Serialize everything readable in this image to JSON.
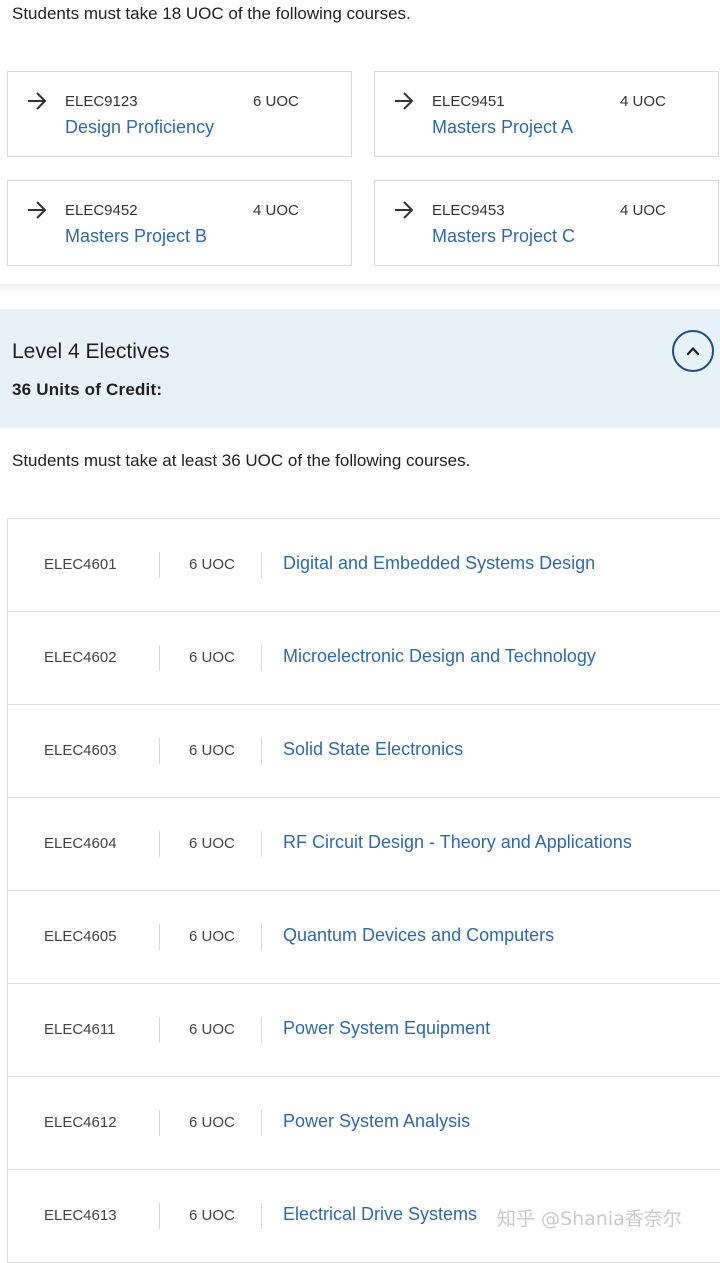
{
  "core": {
    "intro": "Students must take 18 UOC of the following courses.",
    "courses": [
      {
        "code": "ELEC9123",
        "uoc": "6 UOC",
        "title": "Design Proficiency"
      },
      {
        "code": "ELEC9451",
        "uoc": "4 UOC",
        "title": "Masters Project A"
      },
      {
        "code": "ELEC9452",
        "uoc": "4 UOC",
        "title": "Masters Project B"
      },
      {
        "code": "ELEC9453",
        "uoc": "4 UOC",
        "title": "Masters Project C"
      }
    ],
    "arrow_icon": "arrow-right-icon"
  },
  "electives": {
    "heading": "Level 4 Electives",
    "credits": "36 Units of Credit:",
    "toggle_icon": "chevron-up-icon",
    "intro": "Students must take at least 36 UOC of the following courses.",
    "courses": [
      {
        "code": "ELEC4601",
        "uoc": "6 UOC",
        "title": "Digital and Embedded Systems Design"
      },
      {
        "code": "ELEC4602",
        "uoc": "6 UOC",
        "title": "Microelectronic Design and Technology"
      },
      {
        "code": "ELEC4603",
        "uoc": "6 UOC",
        "title": "Solid State Electronics"
      },
      {
        "code": "ELEC4604",
        "uoc": "6 UOC",
        "title": "RF Circuit Design - Theory and Applications"
      },
      {
        "code": "ELEC4605",
        "uoc": "6 UOC",
        "title": "Quantum Devices and Computers"
      },
      {
        "code": "ELEC4611",
        "uoc": "6 UOC",
        "title": "Power System Equipment"
      },
      {
        "code": "ELEC4612",
        "uoc": "6 UOC",
        "title": "Power System Analysis"
      },
      {
        "code": "ELEC4613",
        "uoc": "6 UOC",
        "title": "Electrical Drive Systems"
      }
    ]
  },
  "watermark": "知乎 @Shania香奈尔",
  "colors": {
    "link": "#2f6aa6",
    "header_bg": "#e7f2f8",
    "toggle_border": "#1f4e82"
  }
}
